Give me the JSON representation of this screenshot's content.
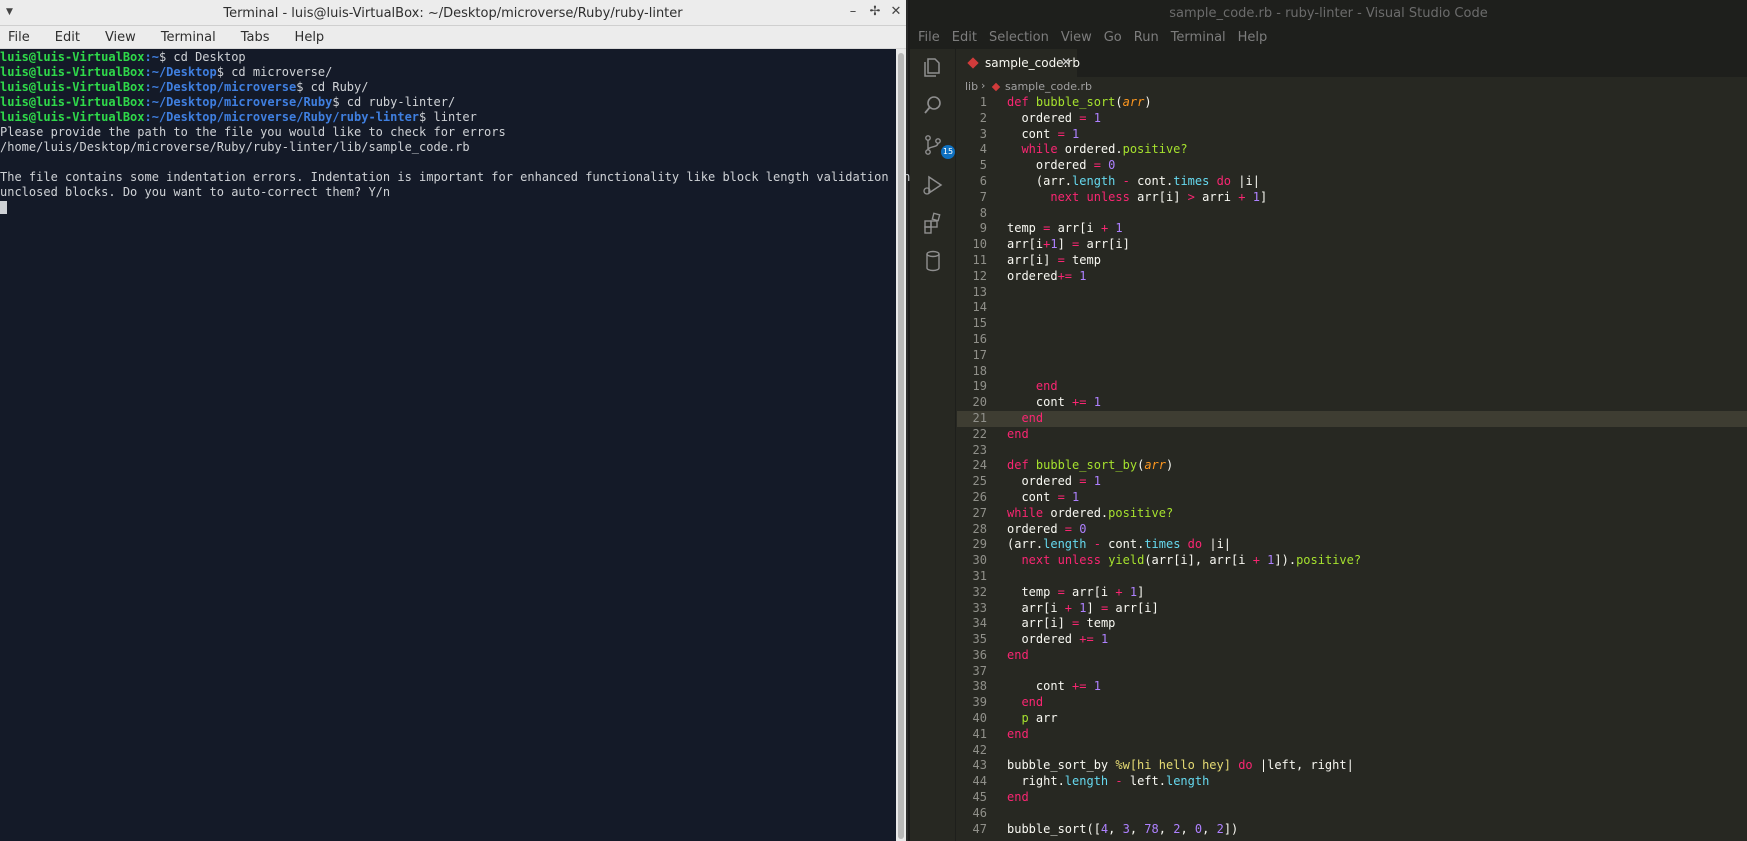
{
  "terminal": {
    "title": "Terminal - luis@luis-VirtualBox: ~/Desktop/microverse/Ruby/ruby-linter",
    "menu": [
      "File",
      "Edit",
      "View",
      "Terminal",
      "Tabs",
      "Help"
    ],
    "lines": [
      {
        "user": "luis@luis-VirtualBox",
        "path": ":~",
        "cmd": "$ cd Desktop"
      },
      {
        "user": "luis@luis-VirtualBox",
        "path": ":~/Desktop",
        "cmd": "$ cd microverse/"
      },
      {
        "user": "luis@luis-VirtualBox",
        "path": ":~/Desktop/microverse",
        "cmd": "$ cd Ruby/"
      },
      {
        "user": "luis@luis-VirtualBox",
        "path": ":~/Desktop/microverse/Ruby",
        "cmd": "$ cd ruby-linter/"
      },
      {
        "user": "luis@luis-VirtualBox",
        "path": ":~/Desktop/microverse/Ruby/ruby-linter",
        "cmd": "$ linter"
      }
    ],
    "output": [
      "Please provide the path to the file you would like to check for errors",
      "/home/luis/Desktop/microverse/Ruby/ruby-linter/lib/sample_code.rb",
      "",
      "The file contains some indentation errors. Indentation is important for enhanced functionality like block length validation and",
      "unclosed blocks. Do you want to auto-correct them? Y/n"
    ]
  },
  "vscode": {
    "title": "sample_code.rb - ruby-linter - Visual Studio Code",
    "menu": [
      "File",
      "Edit",
      "Selection",
      "View",
      "Go",
      "Run",
      "Terminal",
      "Help"
    ],
    "tab_name": "sample_code.rb",
    "breadcrumb": [
      "lib",
      "sample_code.rb"
    ],
    "scm_badge": "15",
    "line_numbers": [
      "1",
      "2",
      "3",
      "4",
      "5",
      "6",
      "7",
      "8",
      "9",
      "10",
      "11",
      "12",
      "13",
      "14",
      "15",
      "16",
      "17",
      "18",
      "19",
      "20",
      "21",
      "22",
      "23",
      "24",
      "25",
      "26",
      "27",
      "28",
      "29",
      "30",
      "31",
      "32",
      "33",
      "34",
      "35",
      "36",
      "37",
      "38",
      "39",
      "40",
      "41",
      "42",
      "43",
      "44",
      "45",
      "46",
      "47"
    ]
  }
}
